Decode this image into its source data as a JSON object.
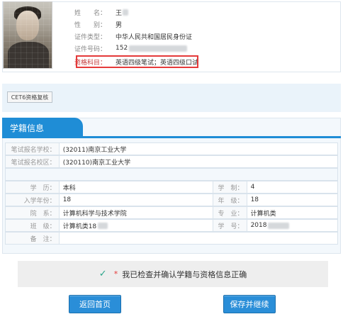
{
  "profile": {
    "name_label": "姓　　名：",
    "name_value": "王",
    "gender_label": "性　　别：",
    "gender_value": "男",
    "id_type_label": "证件类型：",
    "id_type_value": "中华人民共和国居民身份证",
    "id_no_label": "证件号码：",
    "id_no_value": "152",
    "qualification_label": "资格科目：",
    "qualification_value": "英语四级笔试；英语四级口试"
  },
  "cet_button": "CET6资格复核",
  "section_title": "学籍信息",
  "school_rows": [
    {
      "label": "笔试报名学校：",
      "value": "(32011)南京工业大学"
    },
    {
      "label": "笔试报名校区：",
      "value": "(320110)南京工业大学"
    }
  ],
  "detail_rows": [
    {
      "l1": "学　历：",
      "v1": "本科",
      "l2": "学　制：",
      "v2": "4"
    },
    {
      "l1": "入学年份：",
      "v1": "18",
      "l2": "年　级：",
      "v2": "18"
    },
    {
      "l1": "院　系：",
      "v1": "计算机科学与技术学院",
      "l2": "专　业：",
      "v2": "计算机类"
    },
    {
      "l1": "班　级：",
      "v1": "计算机类18",
      "l2": "学　号：",
      "v2": "2018"
    },
    {
      "l1": "备　注：",
      "v1": "",
      "l2": "",
      "v2": ""
    }
  ],
  "confirm_text": "我已检查并确认学籍与资格信息正确",
  "buttons": {
    "back": "返回首页",
    "save": "保存并继续"
  }
}
